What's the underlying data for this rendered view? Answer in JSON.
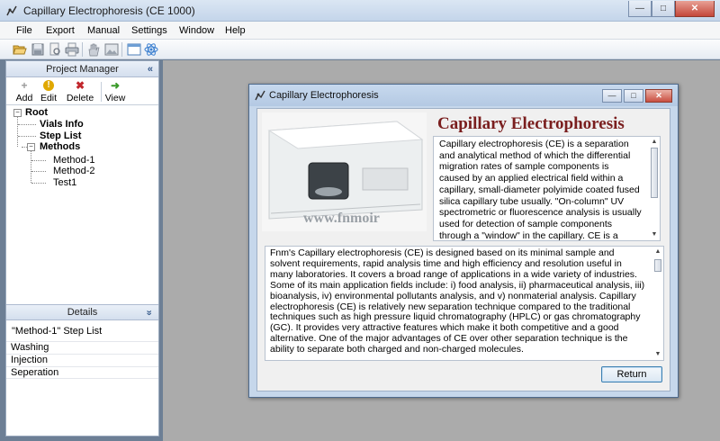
{
  "app": {
    "title": "Capillary Electrophoresis (CE 1000)",
    "window_controls": {
      "minimize": "—",
      "maximize": "□",
      "close": "✕"
    }
  },
  "menu": [
    "File",
    "Export",
    "Manual",
    "Settings",
    "Window",
    "Help"
  ],
  "toolbar": {
    "icons": [
      "open-folder-icon",
      "save-icon",
      "print-preview-icon",
      "print-icon",
      "hand-icon",
      "image-icon",
      "window-icon",
      "atom-icon"
    ]
  },
  "project_manager": {
    "title": "Project Manager",
    "collapse_glyph": "«",
    "buttons": [
      {
        "label": "Add",
        "icon": "+",
        "color": "#9a9a9a"
      },
      {
        "label": "Edit",
        "icon": "!",
        "color": "#e0a800"
      },
      {
        "label": "Delete",
        "icon": "✖",
        "color": "#c1272d"
      },
      {
        "label": "View",
        "icon": "➜",
        "color": "#3a9a2a"
      }
    ],
    "tree": {
      "root": "Root",
      "vials": "Vials Info",
      "steps": "Step List",
      "methods": "Methods",
      "expand_glyph": "−",
      "children": [
        "Method-1",
        "Method-2",
        "Test1"
      ]
    }
  },
  "details": {
    "title": "Details",
    "collapse_glyph": "»",
    "subtitle": "\"Method-1\" Step List",
    "rows": [
      "Washing",
      "Injection",
      "Seperation"
    ]
  },
  "dialog": {
    "title": "Capillary Electrophoresis",
    "heading": "Capillary Electrophoresis",
    "watermark": "www.fnmoir",
    "description": "Capillary electrophoresis (CE) is a separation and analytical method of which the differential migration rates of sample components is caused by an applied electrical field within a capillary, small-diameter polyimide coated fused silica capillary tube usually. \"On-column\" UV spectrometric or fluorescence analysis is usually used for detection of sample components through a \"window\" in the capillary. CE is a powerful technique having a wide range of",
    "info": "Fnm's Capillary electrophoresis (CE) is designed based on its minimal sample and solvent requirements, rapid analysis time and high efficiency and resolution useful in many laboratories. It covers a broad range of applications in a wide variety of industries. Some of its main application fields include: i) food analysis, ii) pharmaceutical analysis, iii) bioanalysis, iv) environmental pollutants analysis, and v) nonmaterial analysis. Capillary electrophoresis (CE) is relatively new separation technique compared to the traditional techniques such as high pressure liquid chromatography (HPLC) or gas chromatography (GC). It provides very attractive features which make it both competitive and a good alternative. One of the major advantages of CE over other separation technique is the ability to separate both charged and non-charged molecules.",
    "return_label": "Return",
    "scroll_up": "▲",
    "scroll_down": "▼"
  },
  "colors": {
    "heading": "#7a1e1e",
    "workspace": "#ababab"
  }
}
